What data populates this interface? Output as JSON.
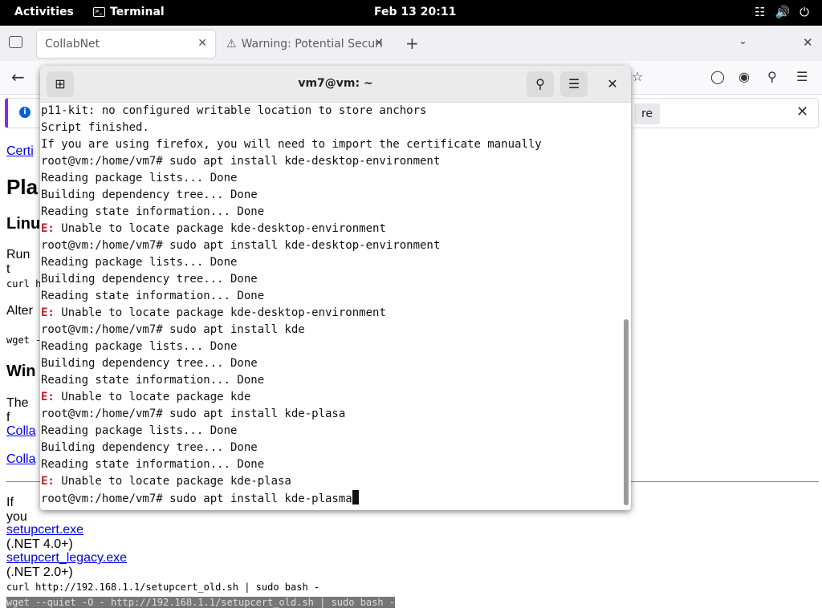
{
  "topbar": {
    "activities": "Activities",
    "app_name": "Terminal",
    "clock": "Feb 13  20:11"
  },
  "tabs": [
    {
      "label": "CollabNet"
    },
    {
      "label": "Warning: Potential Securi"
    }
  ],
  "notification": {
    "button_partial": "re"
  },
  "page": {
    "link1": "Certi",
    "h1": "Pla",
    "h2a": "Linu",
    "run": "Run t",
    "curl_short": "curl h",
    "alter": "Alter",
    "wget_short": "wget -",
    "h2b": "Win",
    "the": "The f",
    "collab1": "Colla",
    "collab2": "Colla",
    "ifyou": "If you",
    "setupcert": "setupcert.exe",
    "setupcert_note": " (.NET 4.0+)",
    "legacy": "setupcert_legacy.exe",
    "legacy_note": " (.NET 2.0+)",
    "curl_full": "curl http://192.168.1.1/setupcert_old.sh | sudo bash -",
    "wget_full": "wget --quiet -O - http://192.168.1.1/setupcert_old.sh | sudo bash -"
  },
  "terminal": {
    "title": "vm7@vm: ~",
    "lines": [
      {
        "err": "",
        "text": "p11-kit: no configured writable location to store anchors"
      },
      {
        "err": "",
        "text": "Script finished."
      },
      {
        "err": "",
        "text": "If you are using firefox, you will need to import the certificate manually"
      },
      {
        "err": "",
        "text": "root@vm:/home/vm7# sudo apt install kde-desktop-environment"
      },
      {
        "err": "",
        "text": "Reading package lists... Done"
      },
      {
        "err": "",
        "text": "Building dependency tree... Done"
      },
      {
        "err": "",
        "text": "Reading state information... Done"
      },
      {
        "err": "E:",
        "text": " Unable to locate package kde-desktop-environment"
      },
      {
        "err": "",
        "text": "root@vm:/home/vm7# sudo apt install kde-desktop-environment"
      },
      {
        "err": "",
        "text": "Reading package lists... Done"
      },
      {
        "err": "",
        "text": "Building dependency tree... Done"
      },
      {
        "err": "",
        "text": "Reading state information... Done"
      },
      {
        "err": "E:",
        "text": " Unable to locate package kde-desktop-environment"
      },
      {
        "err": "",
        "text": "root@vm:/home/vm7# sudo apt install kde"
      },
      {
        "err": "",
        "text": "Reading package lists... Done"
      },
      {
        "err": "",
        "text": "Building dependency tree... Done"
      },
      {
        "err": "",
        "text": "Reading state information... Done"
      },
      {
        "err": "E:",
        "text": " Unable to locate package kde"
      },
      {
        "err": "",
        "text": "root@vm:/home/vm7# sudo apt install kde-plasa"
      },
      {
        "err": "",
        "text": "Reading package lists... Done"
      },
      {
        "err": "",
        "text": "Building dependency tree... Done"
      },
      {
        "err": "",
        "text": "Reading state information... Done"
      },
      {
        "err": "E:",
        "text": " Unable to locate package kde-plasa"
      },
      {
        "err": "",
        "text": "root@vm:/home/vm7# sudo apt install kde-plasma"
      }
    ]
  }
}
